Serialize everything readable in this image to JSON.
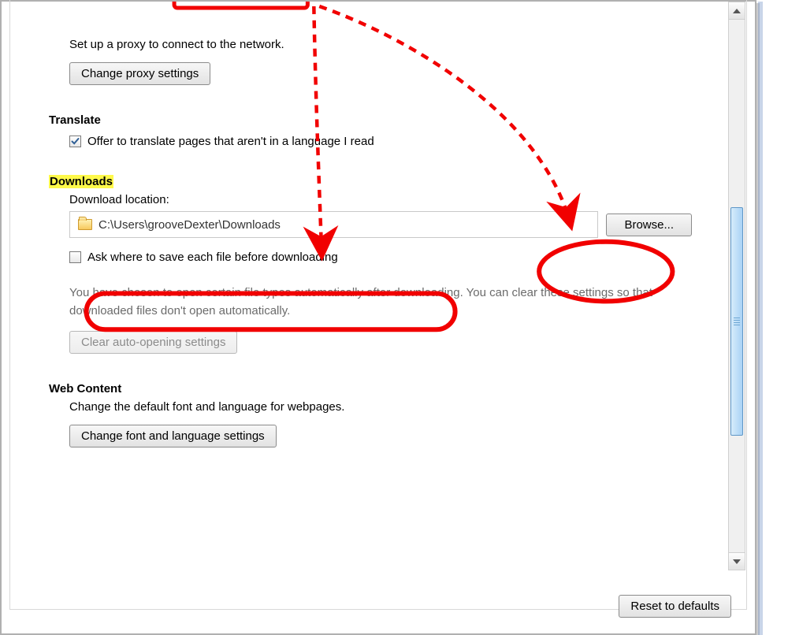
{
  "network": {
    "description": "Set up a proxy to connect to the network.",
    "change_proxy_btn": "Change proxy settings"
  },
  "translate": {
    "heading": "Translate",
    "offer_label": "Offer to translate pages that aren't in a language I read",
    "offer_checked": true
  },
  "downloads": {
    "heading": "Downloads",
    "location_label": "Download location:",
    "location_path": "C:\\Users\\grooveDexter\\Downloads",
    "browse_btn": "Browse...",
    "ask_label": "Ask where to save each file before downloading",
    "ask_checked": false,
    "auto_open_desc": "You have chosen to open certain file types automatically after downloading. You can clear these settings so that downloaded files don't open automatically.",
    "clear_auto_btn": "Clear auto-opening settings"
  },
  "webcontent": {
    "heading": "Web Content",
    "description": "Change the default font and language for webpages.",
    "change_font_btn": "Change font and language settings"
  },
  "footer": {
    "reset_btn": "Reset to defaults"
  }
}
